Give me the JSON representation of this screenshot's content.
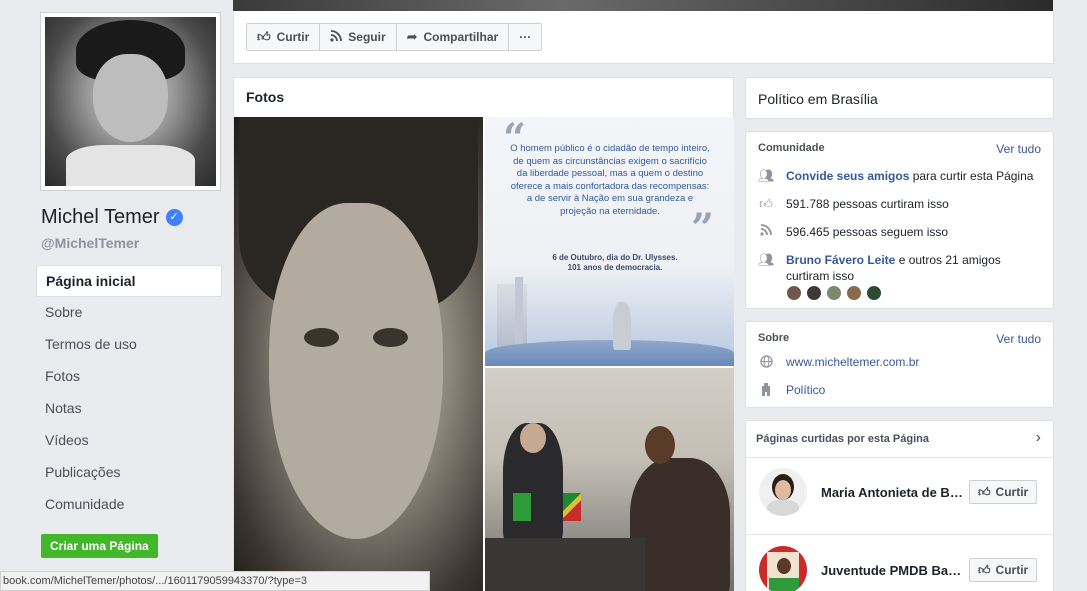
{
  "profile": {
    "name": "Michel Temer",
    "handle": "@MichelTemer"
  },
  "nav": {
    "items": [
      {
        "label": "Página inicial"
      },
      {
        "label": "Sobre"
      },
      {
        "label": "Termos de uso"
      },
      {
        "label": "Fotos"
      },
      {
        "label": "Notas"
      },
      {
        "label": "Vídeos"
      },
      {
        "label": "Publicações"
      },
      {
        "label": "Comunidade"
      }
    ],
    "create_page": "Criar uma Página"
  },
  "actions": {
    "like": "Curtir",
    "follow": "Seguir",
    "share": "Compartilhar",
    "more": "···"
  },
  "photos": {
    "title": "Fotos",
    "quote": "O homem público é o cidadão de tempo inteiro, de quem as circunstâncias exigem o sacrifício da liberdade pessoal, mas a quem o destino oferece a mais confortadora das recompensas: a de servir à Nação em sua grandeza e projeção na eternidade.",
    "quote_date_line1": "6 de Outubro, dia do Dr. Ulysses.",
    "quote_date_line2": "101 anos de democracia."
  },
  "category": "Político em Brasília",
  "community": {
    "title": "Comunidade",
    "see_all": "Ver tudo",
    "invite_link": "Convide seus amigos",
    "invite_rest": " para curtir esta Página",
    "likes": "591.788 pessoas curtiram isso",
    "follows": "596.465 pessoas seguem isso",
    "friend_link": "Bruno Fávero Leite",
    "friend_rest": " e outros 21 amigos curtiram isso"
  },
  "about": {
    "title": "Sobre",
    "see_all": "Ver tudo",
    "website": "www.micheltemer.com.br",
    "category": "Político"
  },
  "liked_pages": {
    "title": "Páginas curtidas por esta Página",
    "items": [
      {
        "name": "Maria Antonieta de Brito",
        "button": "Curtir"
      },
      {
        "name": "Juventude PMDB Bahia",
        "button": "Curtir"
      }
    ]
  },
  "status_url": "book.com/MichelTemer/photos/.../1601179059943370/?type=3",
  "colors": {
    "link": "#365899",
    "verified": "#4080ff",
    "create_button": "#42b72a"
  }
}
